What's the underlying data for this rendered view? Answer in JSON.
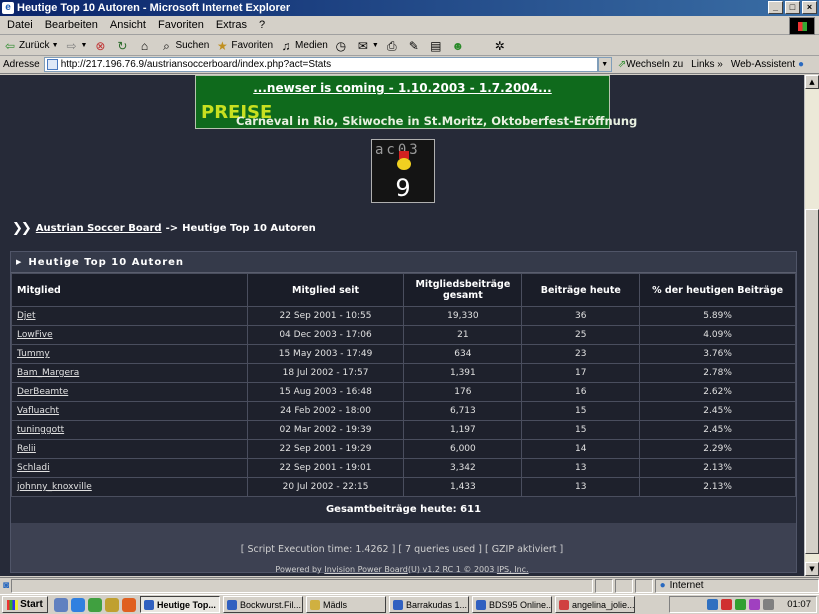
{
  "window": {
    "title": "Heutige Top 10 Autoren - Microsoft Internet Explorer"
  },
  "menu": [
    "Datei",
    "Bearbeiten",
    "Ansicht",
    "Favoriten",
    "Extras",
    "?"
  ],
  "toolbar": {
    "back": "Zurück",
    "search": "Suchen",
    "favorites": "Favoriten",
    "media": "Medien"
  },
  "address": {
    "label": "Adresse",
    "url": "http://217.196.76.9/austriansoccerboard/index.php?act=Stats",
    "go": "Wechseln zu",
    "links": "Links",
    "links_more": "»",
    "assistant": "Web-Assistent"
  },
  "banner": {
    "line1": "...newser is coming - 1.10.2003 - 1.7.2004...",
    "preise": "PREISE",
    "line2": "Carneval in Rio, Skiwoche in St.Moritz, Oktoberfest-Eröffnung"
  },
  "mascot": {
    "tag": "ac03",
    "number": "9"
  },
  "breadcrumb": {
    "board": "Austrian Soccer Board",
    "sep": "->",
    "current": "Heutige Top 10 Autoren"
  },
  "stats": {
    "title": "Heutige Top 10 Autoren",
    "columns": [
      "Mitglied",
      "Mitglied seit",
      "Mitgliedsbeiträge gesamt",
      "Beiträge heute",
      "% der heutigen Beiträge"
    ],
    "rows": [
      [
        "Djet",
        "22 Sep 2001 - 10:55",
        "19,330",
        "36",
        "5.89%"
      ],
      [
        "LowFive",
        "04 Dec 2003 - 17:06",
        "21",
        "25",
        "4.09%"
      ],
      [
        "Tummy",
        "15 May 2003 - 17:49",
        "634",
        "23",
        "3.76%"
      ],
      [
        "Bam_Margera",
        "18 Jul 2002 - 17:57",
        "1,391",
        "17",
        "2.78%"
      ],
      [
        "DerBeamte",
        "15 Aug 2003 - 16:48",
        "176",
        "16",
        "2.62%"
      ],
      [
        "Vafluacht",
        "24 Feb 2002 - 18:00",
        "6,713",
        "15",
        "2.45%"
      ],
      [
        "tuninggott",
        "02 Mar 2002 - 19:39",
        "1,197",
        "15",
        "2.45%"
      ],
      [
        "Relii",
        "22 Sep 2001 - 19:29",
        "6,000",
        "14",
        "2.29%"
      ],
      [
        "Schladi",
        "22 Sep 2001 - 19:01",
        "3,342",
        "13",
        "2.13%"
      ],
      [
        "johnny_knoxville",
        "20 Jul 2002 - 22:15",
        "1,433",
        "13",
        "2.13%"
      ]
    ],
    "total": "Gesamtbeiträge heute: 611"
  },
  "footer": {
    "exec": "[ Script Execution time: 1.4262 ]   [ 7 queries used ]   [ GZIP aktiviert ]",
    "powered_prefix": "Powered by ",
    "powered_link": "Invision Power Board",
    "powered_suffix": "(U) v1.2 RC 1 © 2003 ",
    "ips_link": "IPS, Inc."
  },
  "status": {
    "zone": "Internet"
  },
  "taskbar": {
    "start": "Start",
    "tasks": [
      "Heutige Top...",
      "Bockwurst.Fil...",
      "Mädls",
      "Barrakudas 1...",
      "BDS95 Online...",
      "angelina_jolie..."
    ],
    "clock": "01:07"
  }
}
